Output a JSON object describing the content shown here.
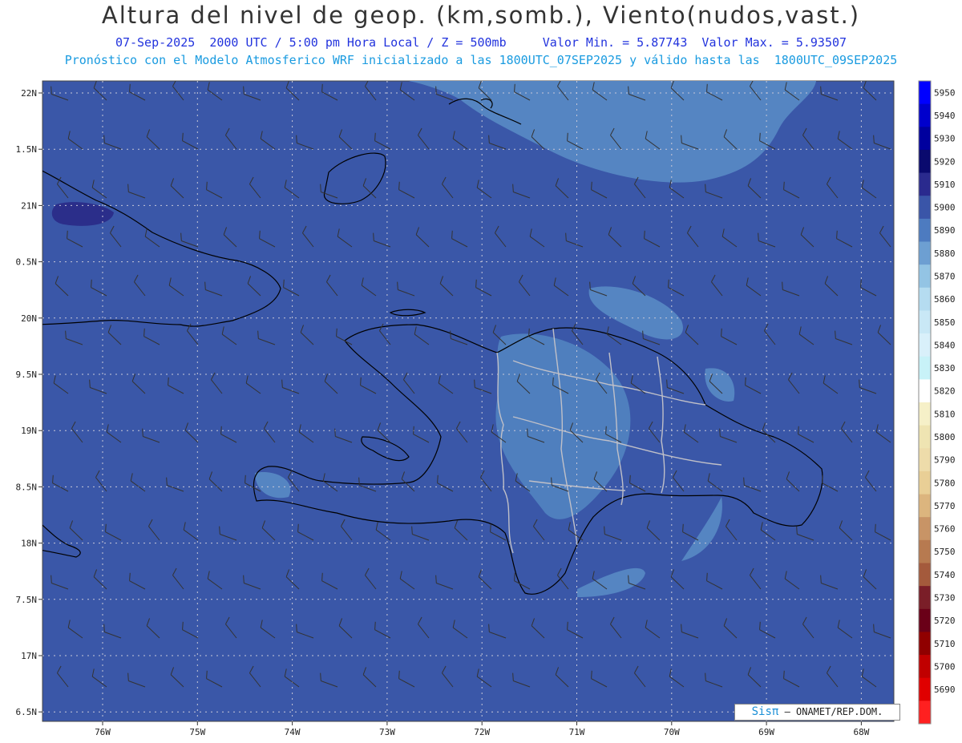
{
  "header": {
    "title": "Altura del nivel de geop. (km,somb.), Viento(nudos,vast.)",
    "line1": "07-Sep-2025  2000 UTC / 5:00 pm Hora Local / Z = 500mb     Valor Min. = 5.87743  Valor Max. = 5.93507",
    "line2": "Pronóstico con el Modelo Atmosferico WRF inicializado a las 1800UTC_07SEP2025 y válido hasta las  1800UTC_09SEP2025"
  },
  "axes": {
    "lat_labels": [
      "22N",
      "1.5N",
      "21N",
      "0.5N",
      "20N",
      "9.5N",
      "19N",
      "8.5N",
      "18N",
      "7.5N",
      "17N",
      "6.5N"
    ],
    "lon_labels": [
      "76W",
      "75W",
      "74W",
      "73W",
      "72W",
      "71W",
      "70W",
      "69W",
      "68W"
    ]
  },
  "colorbar": {
    "labels": [
      "5950",
      "5940",
      "5930",
      "5920",
      "5910",
      "5900",
      "5890",
      "5880",
      "5870",
      "5860",
      "5850",
      "5840",
      "5830",
      "5820",
      "5810",
      "5800",
      "5790",
      "5780",
      "5770",
      "5760",
      "5750",
      "5740",
      "5730",
      "5720",
      "5710",
      "5700",
      "5690"
    ],
    "colors": [
      "#0000ff",
      "#0000cc",
      "#00009e",
      "#0a0a6e",
      "#2a2a8e",
      "#3a55a8",
      "#4d7bc0",
      "#6d9fd2",
      "#93c4e4",
      "#b5dcf0",
      "#c9e8f6",
      "#d9f0fa",
      "#c8f2f8",
      "#ffffff",
      "#f6f0c8",
      "#efe4b2",
      "#eedcaa",
      "#e9cf96",
      "#dcb57e",
      "#c89466",
      "#b77a50",
      "#a45a3c",
      "#7a1e28",
      "#6a0018",
      "#900000",
      "#c00000",
      "#e00000",
      "#ff2020"
    ]
  },
  "legend_colors": {
    "base": "#3a57a8",
    "light": "#4f80bf",
    "dark": "#2b2e8a",
    "border_intl": "#c0c0c8"
  },
  "credit": {
    "brand": "Sisπ",
    "text": "– ONAMET/REP.DOM."
  }
}
